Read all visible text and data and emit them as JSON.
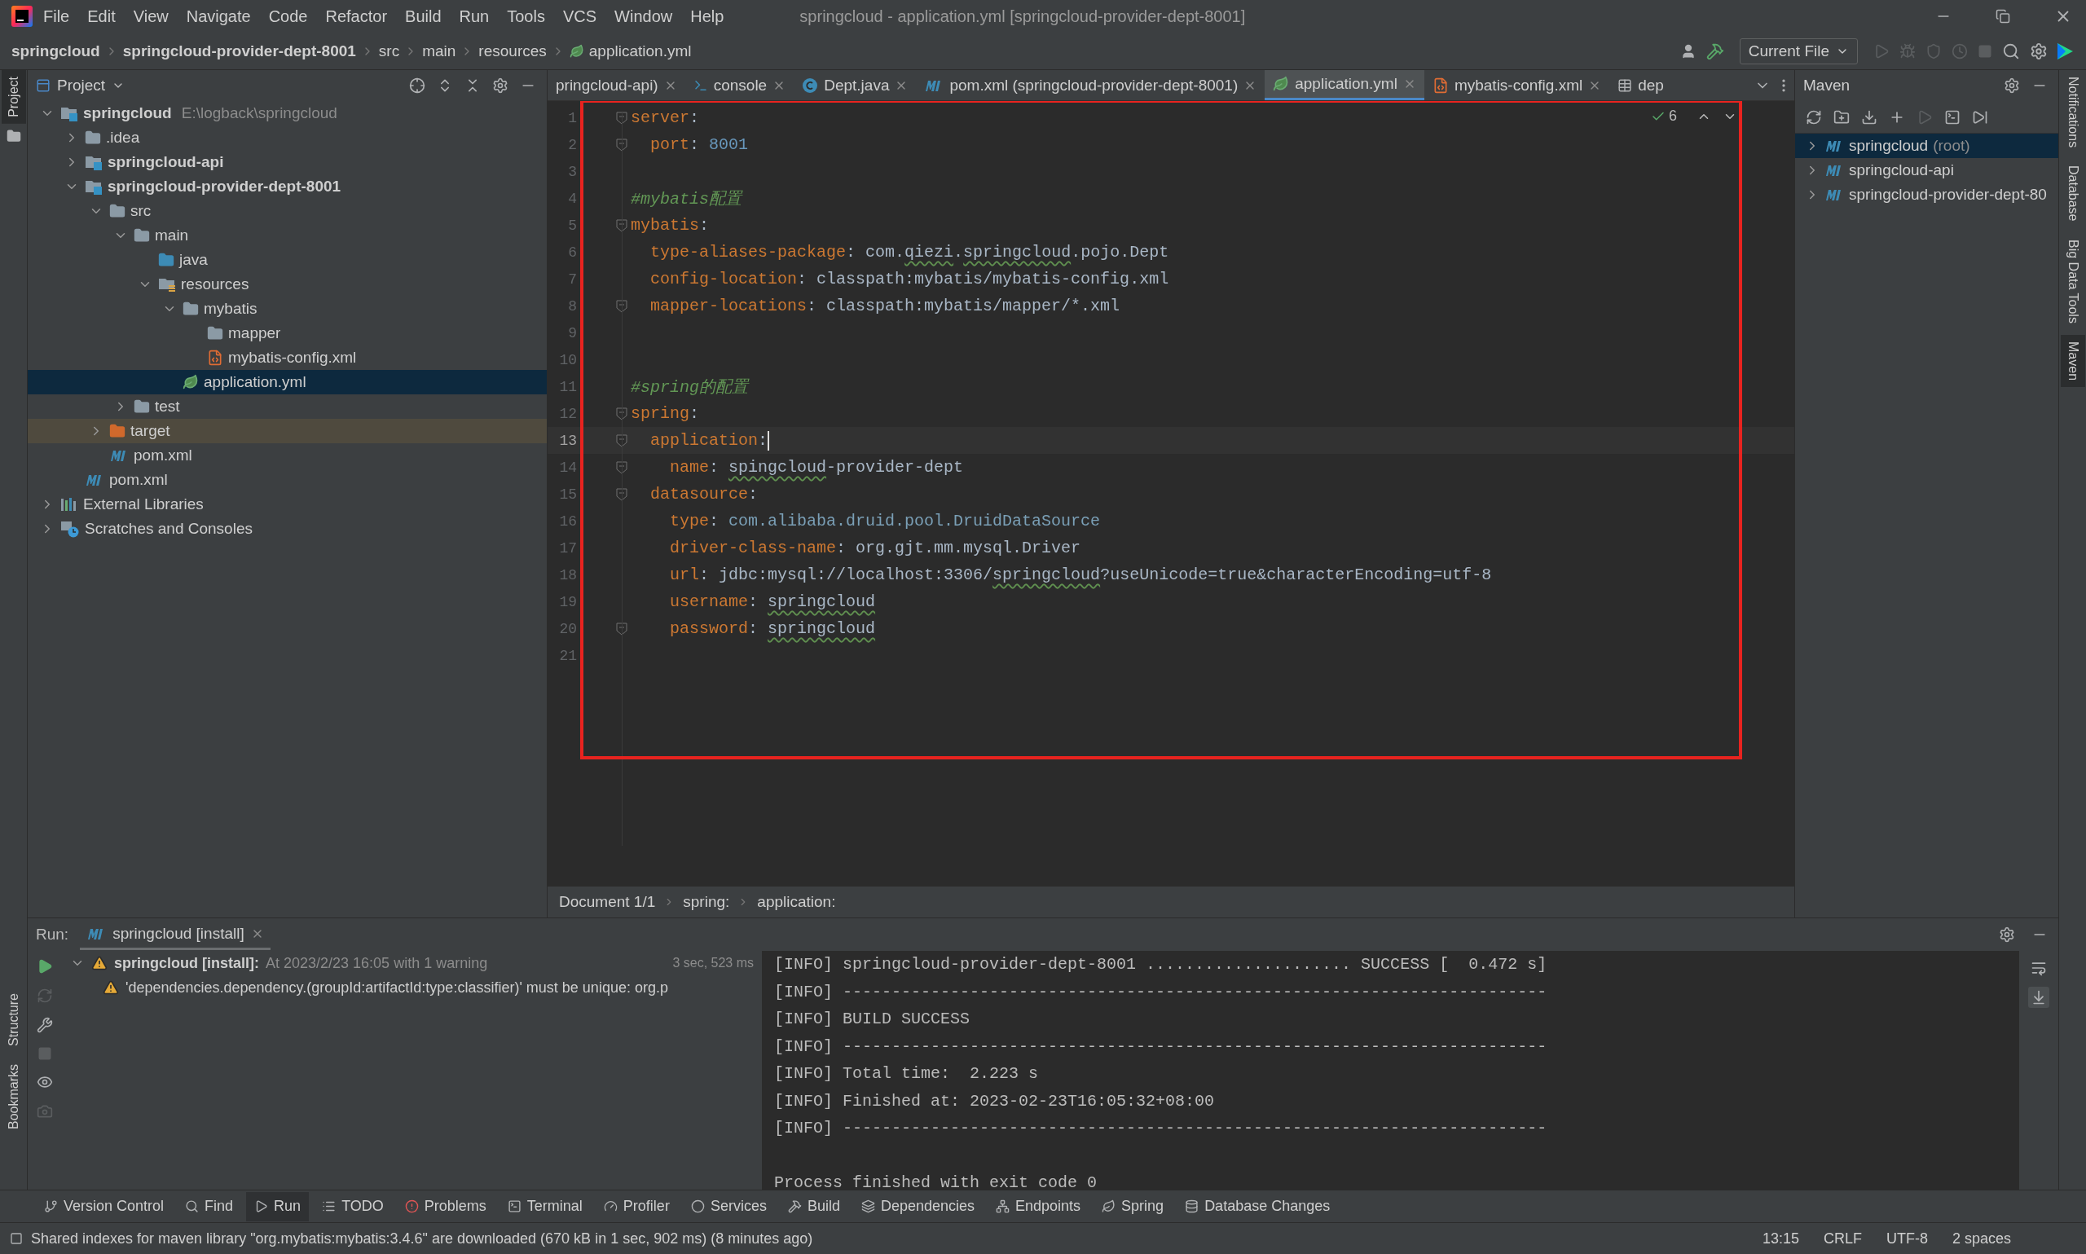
{
  "window": {
    "title": "springcloud - application.yml [springcloud-provider-dept-8001]"
  },
  "menu": [
    "File",
    "Edit",
    "View",
    "Navigate",
    "Code",
    "Refactor",
    "Build",
    "Run",
    "Tools",
    "VCS",
    "Window",
    "Help"
  ],
  "breadcrumbs": [
    {
      "label": "springcloud",
      "bold": true
    },
    {
      "label": "springcloud-provider-dept-8001",
      "bold": true
    },
    {
      "label": "src",
      "bold": false
    },
    {
      "label": "main",
      "bold": false
    },
    {
      "label": "resources",
      "bold": false
    },
    {
      "label": "application.yml",
      "bold": false
    }
  ],
  "run_config": "Current File",
  "left_stripe": [
    {
      "label": "Project",
      "selected": true
    },
    {
      "label": "Structure",
      "selected": false
    },
    {
      "label": "Bookmarks",
      "selected": false
    }
  ],
  "right_stripe": [
    {
      "label": "Notifications",
      "selected": false
    },
    {
      "label": "Database",
      "selected": false
    },
    {
      "label": "Big Data Tools",
      "selected": false
    },
    {
      "label": "Maven",
      "selected": true
    }
  ],
  "project": {
    "title": "Project",
    "tree": [
      {
        "label": "springcloud",
        "path": "E:\\logback\\springcloud",
        "kind": "module",
        "expanded": true,
        "selected": false,
        "children": [
          {
            "label": ".idea",
            "kind": "folder",
            "expanded": false,
            "selected": false
          },
          {
            "label": "springcloud-api",
            "kind": "module",
            "expanded": false,
            "selected": false
          },
          {
            "label": "springcloud-provider-dept-8001",
            "kind": "module",
            "expanded": true,
            "selected": false,
            "children": [
              {
                "label": "src",
                "kind": "folder",
                "expanded": true,
                "selected": false,
                "children": [
                  {
                    "label": "main",
                    "kind": "folder",
                    "expanded": true,
                    "selected": false,
                    "children": [
                      {
                        "label": "java",
                        "kind": "source-folder",
                        "selected": false
                      },
                      {
                        "label": "resources",
                        "kind": "resource-folder",
                        "expanded": true,
                        "selected": false,
                        "children": [
                          {
                            "label": "mybatis",
                            "kind": "folder",
                            "expanded": true,
                            "selected": false,
                            "children": [
                              {
                                "label": "mapper",
                                "kind": "folder",
                                "selected": false
                              },
                              {
                                "label": "mybatis-config.xml",
                                "kind": "xml",
                                "selected": false
                              }
                            ]
                          },
                          {
                            "label": "application.yml",
                            "kind": "yml",
                            "selected": true
                          }
                        ]
                      }
                    ]
                  },
                  {
                    "label": "test",
                    "kind": "folder",
                    "expanded": false,
                    "selected": false
                  }
                ]
              },
              {
                "label": "target",
                "kind": "excluded-folder",
                "expanded": false,
                "selected": false
              },
              {
                "label": "pom.xml",
                "kind": "maven",
                "selected": false
              }
            ]
          },
          {
            "label": "pom.xml",
            "kind": "maven",
            "selected": false
          }
        ]
      },
      {
        "label": "External Libraries",
        "kind": "libraries",
        "expanded": false,
        "selected": false
      },
      {
        "label": "Scratches and Consoles",
        "kind": "scratches",
        "expanded": false,
        "selected": false
      }
    ]
  },
  "editor_tabs": [
    {
      "label": "pringcloud-api)",
      "kind": "text",
      "selected": false,
      "closable": true
    },
    {
      "label": "console",
      "kind": "console",
      "selected": false,
      "closable": true
    },
    {
      "label": "Dept.java",
      "kind": "class",
      "selected": false,
      "closable": true
    },
    {
      "label": "pom.xml (springcloud-provider-dept-8001)",
      "kind": "maven",
      "selected": false,
      "closable": true
    },
    {
      "label": "application.yml",
      "kind": "yml",
      "selected": true,
      "closable": true
    },
    {
      "label": "mybatis-config.xml",
      "kind": "xml",
      "selected": false,
      "closable": true
    },
    {
      "label": "dep",
      "kind": "table",
      "selected": false,
      "closable": false
    }
  ],
  "inspections": "6",
  "code": [
    {
      "number": "1",
      "fold": true,
      "selected": false,
      "segments": [
        {
          "kind": "key",
          "text": "server"
        },
        {
          "kind": "punct",
          "text": ":"
        }
      ]
    },
    {
      "number": "2",
      "fold": true,
      "selected": false,
      "segments": [
        {
          "kind": "key",
          "text": "  port"
        },
        {
          "kind": "punct",
          "text": ": "
        },
        {
          "kind": "number",
          "text": "8001"
        }
      ]
    },
    {
      "number": "3",
      "fold": false,
      "selected": false
    },
    {
      "number": "4",
      "fold": false,
      "selected": false,
      "segments": [
        {
          "kind": "comment",
          "text": "#mybatis配置"
        }
      ]
    },
    {
      "number": "5",
      "fold": true,
      "selected": false,
      "segments": [
        {
          "kind": "key",
          "text": "mybatis"
        },
        {
          "kind": "punct",
          "text": ":"
        }
      ]
    },
    {
      "number": "6",
      "fold": false,
      "selected": false,
      "segments": [
        {
          "kind": "key",
          "text": "  type-aliases-package"
        },
        {
          "kind": "punct",
          "text": ": "
        },
        {
          "kind": "value",
          "text": "com."
        },
        {
          "kind": "typo",
          "text": "qiezi"
        },
        {
          "kind": "value",
          "text": "."
        },
        {
          "kind": "typo",
          "text": "springcloud"
        },
        {
          "kind": "value",
          "text": ".pojo.Dept"
        }
      ]
    },
    {
      "number": "7",
      "fold": false,
      "selected": false,
      "segments": [
        {
          "kind": "key",
          "text": "  config-location"
        },
        {
          "kind": "punct",
          "text": ": "
        },
        {
          "kind": "value",
          "text": "classpath:mybatis/mybatis-config.xml"
        }
      ]
    },
    {
      "number": "8",
      "fold": true,
      "selected": false,
      "segments": [
        {
          "kind": "key",
          "text": "  mapper-locations"
        },
        {
          "kind": "punct",
          "text": ": "
        },
        {
          "kind": "value",
          "text": "classpath:mybatis/mapper/*.xml"
        }
      ]
    },
    {
      "number": "9",
      "fold": false,
      "selected": false
    },
    {
      "number": "10",
      "fold": false,
      "selected": false
    },
    {
      "number": "11",
      "fold": false,
      "selected": false,
      "segments": [
        {
          "kind": "comment",
          "text": "#spring的配置"
        }
      ]
    },
    {
      "number": "12",
      "fold": true,
      "selected": false,
      "segments": [
        {
          "kind": "key",
          "text": "spring"
        },
        {
          "kind": "punct",
          "text": ":"
        }
      ]
    },
    {
      "number": "13",
      "fold": true,
      "selected": true,
      "segments": [
        {
          "kind": "key",
          "text": "  application"
        },
        {
          "kind": "punct",
          "text": ":"
        }
      ]
    },
    {
      "number": "14",
      "fold": true,
      "selected": false,
      "segments": [
        {
          "kind": "key",
          "text": "    name"
        },
        {
          "kind": "punct",
          "text": ": "
        },
        {
          "kind": "typo",
          "text": "spingcloud"
        },
        {
          "kind": "value",
          "text": "-provider-dept"
        }
      ]
    },
    {
      "number": "15",
      "fold": true,
      "selected": false,
      "segments": [
        {
          "kind": "key",
          "text": "  datasource"
        },
        {
          "kind": "punct",
          "text": ":"
        }
      ]
    },
    {
      "number": "16",
      "fold": false,
      "selected": false,
      "segments": [
        {
          "kind": "key",
          "text": "    type"
        },
        {
          "kind": "punct",
          "text": ": "
        },
        {
          "kind": "class",
          "text": "com.alibaba.druid.pool.DruidDataSource"
        }
      ]
    },
    {
      "number": "17",
      "fold": false,
      "selected": false,
      "segments": [
        {
          "kind": "key",
          "text": "    driver-class-name"
        },
        {
          "kind": "punct",
          "text": ": "
        },
        {
          "kind": "value",
          "text": "org.gjt.mm.mysql.Driver"
        }
      ]
    },
    {
      "number": "18",
      "fold": false,
      "selected": false,
      "segments": [
        {
          "kind": "key",
          "text": "    url"
        },
        {
          "kind": "punct",
          "text": ": "
        },
        {
          "kind": "value",
          "text": "jdbc:mysql://localhost:3306/"
        },
        {
          "kind": "typo",
          "text": "springcloud"
        },
        {
          "kind": "value",
          "text": "?useUnicode=true&characterEncoding=utf-8"
        }
      ]
    },
    {
      "number": "19",
      "fold": false,
      "selected": false,
      "segments": [
        {
          "kind": "key",
          "text": "    username"
        },
        {
          "kind": "punct",
          "text": ": "
        },
        {
          "kind": "typo",
          "text": "springcloud"
        }
      ]
    },
    {
      "number": "20",
      "fold": true,
      "selected": false,
      "segments": [
        {
          "kind": "key",
          "text": "    password"
        },
        {
          "kind": "punct",
          "text": ": "
        },
        {
          "kind": "typo",
          "text": "springcloud"
        }
      ]
    },
    {
      "number": "21",
      "fold": false,
      "selected": false
    }
  ],
  "editor_breadcrumbs": [
    "Document 1/1",
    "spring:",
    "application:"
  ],
  "maven": {
    "title": "Maven",
    "tree": [
      {
        "label": "springcloud",
        "secondary": "(root)",
        "selected": true
      },
      {
        "label": "springcloud-api",
        "selected": false
      },
      {
        "label": "springcloud-provider-dept-80",
        "selected": false
      }
    ]
  },
  "run": {
    "label": "Run:",
    "tab": "springcloud [install]",
    "result": {
      "title": "springcloud [install]:",
      "detail": "At 2023/2/23 16:05 with 1 warning",
      "time": "3 sec, 523 ms",
      "warning": "'dependencies.dependency.(groupId:artifactId:type:classifier)' must be unique: org.p"
    },
    "console": [
      "[INFO] springcloud-provider-dept-8001 ..................... SUCCESS [  0.472 s]",
      "[INFO] ------------------------------------------------------------------------",
      "[INFO] BUILD SUCCESS",
      "[INFO] ------------------------------------------------------------------------",
      "[INFO] Total time:  2.223 s",
      "[INFO] Finished at: 2023-02-23T16:05:32+08:00",
      "[INFO] ------------------------------------------------------------------------"
    ],
    "exit_message": "Process finished with exit code 0"
  },
  "tool_tabs": [
    {
      "label": "Version Control",
      "selected": false
    },
    {
      "label": "Find",
      "selected": false
    },
    {
      "label": "Run",
      "selected": true
    },
    {
      "label": "TODO",
      "selected": false
    },
    {
      "label": "Problems",
      "selected": false
    },
    {
      "label": "Terminal",
      "selected": false
    },
    {
      "label": "Profiler",
      "selected": false
    },
    {
      "label": "Services",
      "selected": false
    },
    {
      "label": "Build",
      "selected": false
    },
    {
      "label": "Dependencies",
      "selected": false
    },
    {
      "label": "Endpoints",
      "selected": false
    },
    {
      "label": "Spring",
      "selected": false
    },
    {
      "label": "Database Changes",
      "selected": false
    }
  ],
  "status_bar": {
    "message": "Shared indexes for maven library \"org.mybatis:mybatis:3.4.6\" are downloaded (670 kB in 1 sec, 902 ms) (8 minutes ago)",
    "items": [
      "13:15",
      "CRLF",
      "UTF-8",
      "2 spaces"
    ]
  }
}
